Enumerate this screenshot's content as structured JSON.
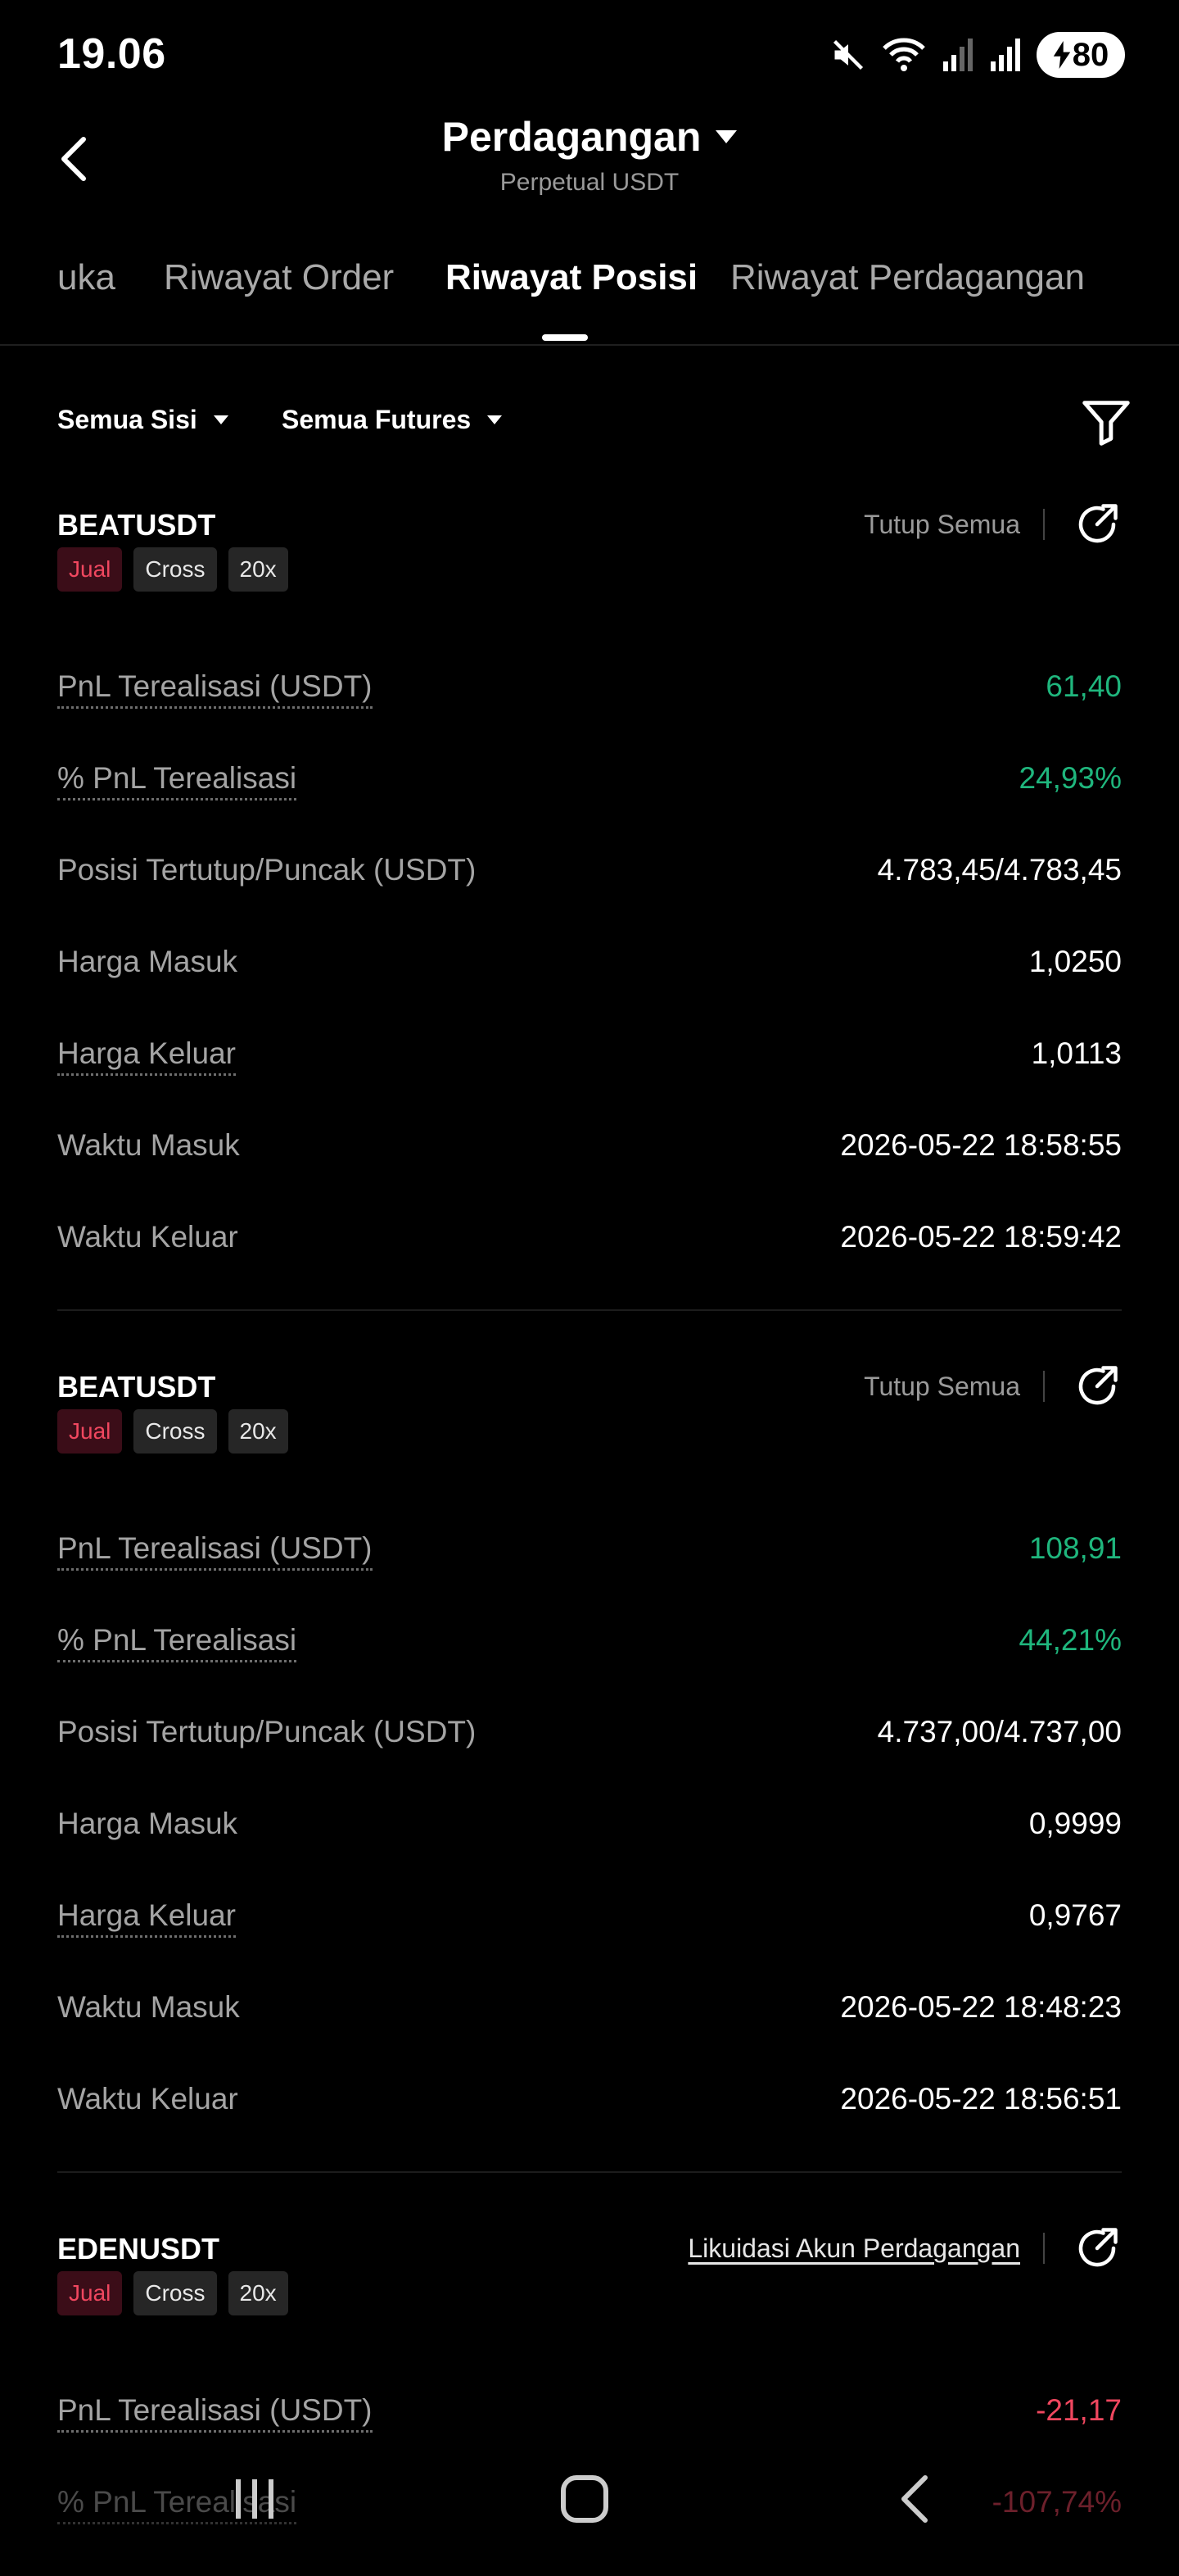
{
  "status_bar": {
    "time": "19.06",
    "battery": "80",
    "icons": [
      "mute-icon",
      "wifi-icon",
      "signal-icon",
      "signal-icon",
      "battery-charging-icon"
    ]
  },
  "header": {
    "title": "Perdagangan",
    "subtitle": "Perpetual USDT"
  },
  "tabs": [
    {
      "label": "uka",
      "active": false
    },
    {
      "label": "Riwayat Order",
      "active": false
    },
    {
      "label": "Riwayat Posisi",
      "active": true
    },
    {
      "label": "Riwayat Perdagangan",
      "active": false
    }
  ],
  "filters": {
    "side": "Semua Sisi",
    "futures": "Semua Futures"
  },
  "colors": {
    "profit": "#1fb67d",
    "loss": "#f0475f",
    "background": "#000000"
  },
  "positions": [
    {
      "symbol": "BEATUSDT",
      "action": "Tutup Semua",
      "tags": {
        "side": "Jual",
        "margin": "Cross",
        "leverage": "20x"
      },
      "rows": [
        {
          "label": "PnL Terealisasi (USDT)",
          "value": "61,40"
        },
        {
          "label": "% PnL Terealisasi",
          "value": "24,93%"
        },
        {
          "label": "Posisi Tertutup/Puncak (USDT)",
          "value": "4.783,45/4.783,45"
        },
        {
          "label": "Harga Masuk",
          "value": "1,0250"
        },
        {
          "label": "Harga Keluar",
          "value": "1,0113"
        },
        {
          "label": "Waktu Masuk",
          "value": "2026-05-22 18:58:55"
        },
        {
          "label": "Waktu Keluar",
          "value": "2026-05-22 18:59:42"
        }
      ]
    },
    {
      "symbol": "BEATUSDT",
      "action": "Tutup Semua",
      "tags": {
        "side": "Jual",
        "margin": "Cross",
        "leverage": "20x"
      },
      "rows": [
        {
          "label": "PnL Terealisasi (USDT)",
          "value": "108,91"
        },
        {
          "label": "% PnL Terealisasi",
          "value": "44,21%"
        },
        {
          "label": "Posisi Tertutup/Puncak (USDT)",
          "value": "4.737,00/4.737,00"
        },
        {
          "label": "Harga Masuk",
          "value": "0,9999"
        },
        {
          "label": "Harga Keluar",
          "value": "0,9767"
        },
        {
          "label": "Waktu Masuk",
          "value": "2026-05-22 18:48:23"
        },
        {
          "label": "Waktu Keluar",
          "value": "2026-05-22 18:56:51"
        }
      ]
    },
    {
      "symbol": "EDENUSDT",
      "action": "Likuidasi Akun Perdagangan",
      "tags": {
        "side": "Jual",
        "margin": "Cross",
        "leverage": "20x"
      },
      "rows": [
        {
          "label": "PnL Terealisasi (USDT)",
          "value": "-21,17"
        },
        {
          "label": "% PnL Terealisasi",
          "value": "-107,74%"
        }
      ]
    }
  ]
}
